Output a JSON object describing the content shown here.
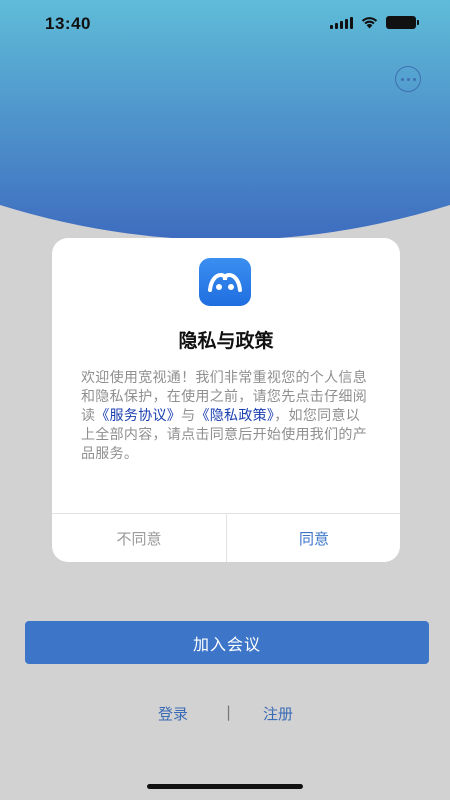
{
  "status_bar": {
    "time": "13:40",
    "icons": [
      "signal-icon",
      "wifi-icon",
      "battery-icon"
    ]
  },
  "header": {
    "more_icon": "more-icon"
  },
  "dialog": {
    "logo_icon": "app-logo-icon",
    "title": "隐私与政策",
    "body": {
      "intro": "欢迎使用宽视通！我们非常重视您的个人信息和隐私保护，在使用之前，请您先点击仔细阅读",
      "service_link": "《服务协议》",
      "and": "与",
      "privacy_link": "《隐私政策》",
      "outro": "，如您同意以上全部内容，请点击同意后开始使用我们的产品服务。"
    },
    "disagree_label": "不同意",
    "agree_label": "同意"
  },
  "main": {
    "join_meeting_label": "加入会议"
  },
  "bottom": {
    "login_label": "登录",
    "separator": "|",
    "register_label": "注册"
  },
  "colors": {
    "gradient_top": "#5bb8d6",
    "gradient_bottom": "#3f6fc0",
    "accent": "#3d76c9",
    "link": "#1a3fb0",
    "overlay_bg": "#d2d2d2"
  }
}
